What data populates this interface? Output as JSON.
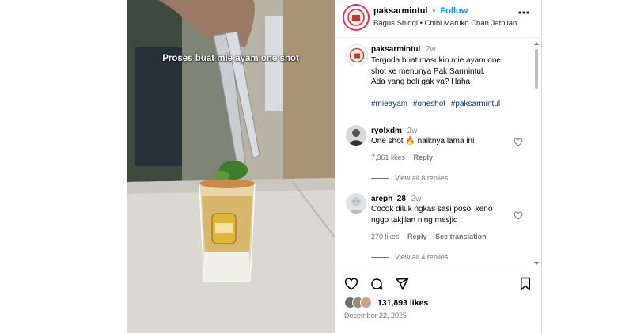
{
  "media": {
    "caption_overlay": "Proses buat mie ayam one shot"
  },
  "header": {
    "username": "paksarmintul",
    "separator": "•",
    "follow_label": "Follow",
    "audio": "Bagus Shidqi • Chibi Maruko Chan Jathilan",
    "more_icon": "more-horizontal-icon"
  },
  "caption": {
    "username": "paksarmintul",
    "age": "2w",
    "lines": [
      "Tergoda buat masukin mie ayam one",
      "shot ke menunya Pak Sarmintul.",
      "Ada yang beli gak ya? Haha"
    ],
    "hashtags": [
      "#mieayam",
      "#oneshot",
      "#paksarmintul"
    ]
  },
  "comments": [
    {
      "username": "ryolxdm",
      "age": "2w",
      "text": "One shot 🔥 naiknya lama ini",
      "likes": "7,361 likes",
      "reply_label": "Reply",
      "translation": "",
      "view_replies": "View all 8 replies"
    },
    {
      "username": "areph_28",
      "age": "2w",
      "text_lines": [
        "Cocok diluk ngkas sasi poso, keno",
        "nggo takjilan ning mesjid"
      ],
      "likes": "270 likes",
      "reply_label": "Reply",
      "translation": "See translation",
      "view_replies": "View all 4 replies"
    }
  ],
  "actions": {
    "like_icon": "heart-icon",
    "comment_icon": "comment-icon",
    "share_icon": "share-icon",
    "save_icon": "bookmark-icon",
    "likes_count": "131,893",
    "likes_word": "likes",
    "date": "December 22, 2025"
  },
  "colors": {
    "link_blue": "#0095f6",
    "hashtag": "#00376b",
    "muted": "#737373"
  }
}
